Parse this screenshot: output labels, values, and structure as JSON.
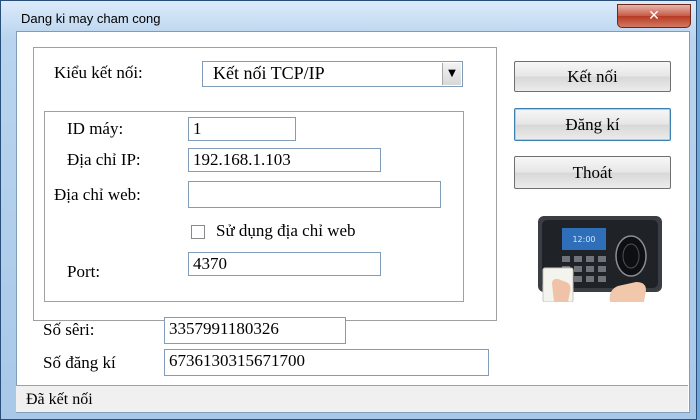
{
  "window": {
    "title": "Dang ki may cham cong",
    "close_glyph": "✕"
  },
  "connection": {
    "type_label": "Kiểu kết nối:",
    "type_value": "Kết nối TCP/IP",
    "dropdown_arrow": "▼"
  },
  "fields": {
    "device_id_label": "ID máy:",
    "device_id_value": "1",
    "ip_label": "Địa chỉ IP:",
    "ip_value": "192.168.1.103",
    "web_label": "Địa chỉ web:",
    "web_value": "",
    "use_web_label": "Sử dụng địa chỉ web",
    "use_web_checked": false,
    "port_label": "Port:",
    "port_value": "4370"
  },
  "registration": {
    "serial_label": "Số sêri:",
    "serial_value": "3357991180326",
    "reg_number_label": "Số đăng kí",
    "reg_number_value": "6736130315671700"
  },
  "buttons": {
    "connect": "Kết nối",
    "register": "Đăng kí",
    "exit": "Thoát"
  },
  "status": {
    "text": "Đã kết nối"
  },
  "image": {
    "icon": "fingerprint-device-image"
  }
}
